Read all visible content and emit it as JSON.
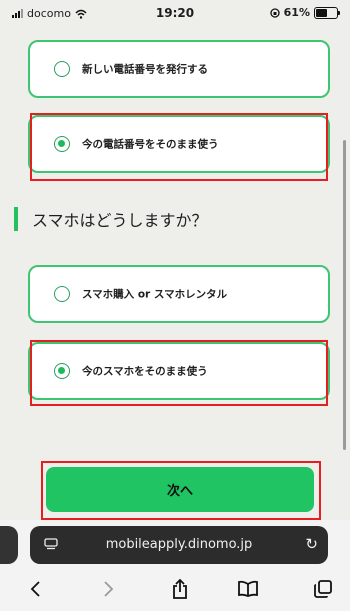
{
  "status_bar": {
    "carrier": "docomo",
    "time": "19:20",
    "battery_percent": "61%",
    "battery_level": 0.61
  },
  "phone_number_options": [
    {
      "label": "新しい電話番号を発行する",
      "selected": false
    },
    {
      "label": "今の電話番号をそのまま使う",
      "selected": true
    }
  ],
  "smartphone_question": "スマホはどうしますか？",
  "smartphone_options": [
    {
      "label": "スマホ購入 or スマホレンタル",
      "selected": false
    },
    {
      "label": "今のスマホをそのまま使う",
      "selected": true
    }
  ],
  "next_button_label": "次へ",
  "browser": {
    "url": "mobileapply.dinomo.jp"
  },
  "colors": {
    "accent_green": "#20c463",
    "highlight_red": "#e51f1f",
    "background": "#eeeeea"
  }
}
